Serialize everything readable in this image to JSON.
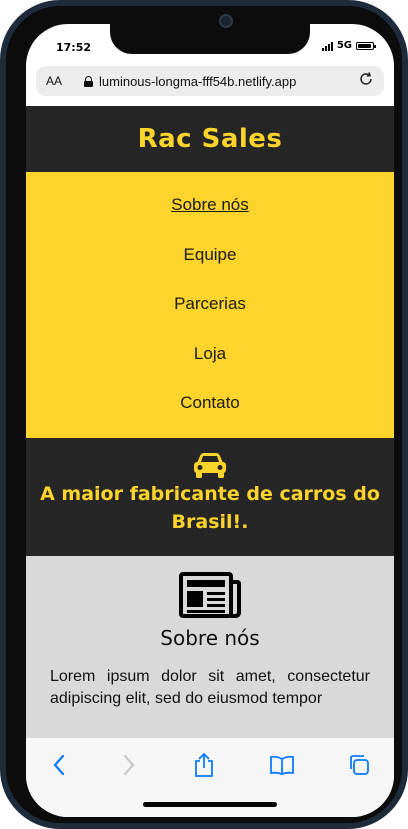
{
  "status_bar": {
    "time": "17:52",
    "network": "5G",
    "battery_level": 0.9
  },
  "browser": {
    "text_size_button": "AA",
    "url": "luminous-longma-fff54b.netlify.app",
    "reload_icon": "reload-icon"
  },
  "site": {
    "brand": "Rac Sales",
    "nav": [
      {
        "label": "Sobre nós",
        "active": true
      },
      {
        "label": "Equipe"
      },
      {
        "label": "Parcerias"
      },
      {
        "label": "Loja"
      },
      {
        "label": "Contato"
      }
    ],
    "hero": {
      "icon": "car-icon",
      "text": "A maior fabricante de carros do Brasil!."
    },
    "about": {
      "icon": "newspaper-icon",
      "title": "Sobre nós",
      "text": "Lorem ipsum dolor sit amet, consectetur adipiscing elit, sed do eiusmod tempor"
    }
  },
  "colors": {
    "accent": "#fdd42b",
    "dark": "#262626",
    "section_bg": "#d9d9d9",
    "ios_blue": "#0a7aff"
  },
  "toolbar": {
    "items": [
      "back-icon",
      "forward-icon",
      "share-icon",
      "bookmarks-icon",
      "tabs-icon"
    ]
  }
}
